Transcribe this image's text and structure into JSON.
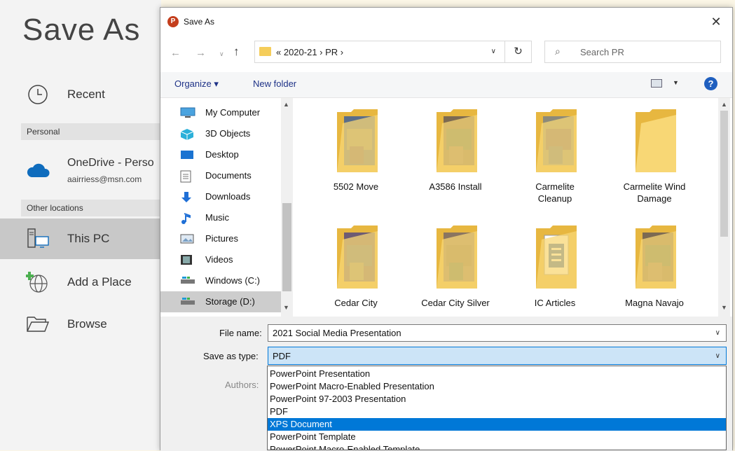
{
  "backstage": {
    "title": "Save As",
    "recent_label": "Recent",
    "personal_section": "Personal",
    "onedrive_name": "OneDrive - Perso",
    "onedrive_email": "aairriess@msn.com",
    "other_section": "Other locations",
    "this_pc_label": "This PC",
    "add_place_label": "Add a Place",
    "browse_label": "Browse"
  },
  "dialog": {
    "title": "Save As",
    "app_icon_letter": "P",
    "close_glyph": "✕",
    "address": {
      "path": "«  2020-21  ›  PR  ›"
    },
    "search_placeholder": "Search PR",
    "toolbar": {
      "organize_label": "Organize ▾",
      "new_folder_label": "New folder",
      "help_glyph": "?"
    },
    "nav_items": [
      {
        "label": "My Computer",
        "icon": "computer-icon",
        "selected": false
      },
      {
        "label": "3D Objects",
        "icon": "3d-objects-icon",
        "selected": false
      },
      {
        "label": "Desktop",
        "icon": "desktop-icon",
        "selected": false
      },
      {
        "label": "Documents",
        "icon": "documents-icon",
        "selected": false
      },
      {
        "label": "Downloads",
        "icon": "downloads-icon",
        "selected": false
      },
      {
        "label": "Music",
        "icon": "music-icon",
        "selected": false
      },
      {
        "label": "Pictures",
        "icon": "pictures-icon",
        "selected": false
      },
      {
        "label": "Videos",
        "icon": "videos-icon",
        "selected": false
      },
      {
        "label": "Windows (C:)",
        "icon": "drive-icon",
        "selected": false
      },
      {
        "label": "Storage (D:)",
        "icon": "drive-icon",
        "selected": true
      }
    ],
    "folders": [
      {
        "name": "5502 Move",
        "kind": "photo"
      },
      {
        "name": "A3586 Install",
        "kind": "photo"
      },
      {
        "name": "Carmelite\nCleanup",
        "kind": "photo"
      },
      {
        "name": "Carmelite Wind\nDamage",
        "kind": "empty"
      },
      {
        "name": "Cedar City",
        "kind": "photo"
      },
      {
        "name": "Cedar City Silver",
        "kind": "photo"
      },
      {
        "name": "IC Articles",
        "kind": "docs"
      },
      {
        "name": "Magna Navajo",
        "kind": "photo"
      }
    ],
    "file_name_label": "File name:",
    "file_name_value": "2021 Social Media Presentation",
    "save_type_label": "Save as type:",
    "save_type_value": "PDF",
    "authors_label": "Authors:",
    "type_options": [
      {
        "label": "PowerPoint Presentation",
        "highlighted": false
      },
      {
        "label": "PowerPoint Macro-Enabled Presentation",
        "highlighted": false
      },
      {
        "label": "PowerPoint 97-2003 Presentation",
        "highlighted": false
      },
      {
        "label": "PDF",
        "highlighted": false
      },
      {
        "label": "XPS Document",
        "highlighted": true
      },
      {
        "label": "PowerPoint Template",
        "highlighted": false
      },
      {
        "label": "PowerPoint Macro-Enabled Template",
        "highlighted": false
      }
    ]
  },
  "colors": {
    "accent": "#0078d7",
    "selection_bg": "#cce4f7",
    "folder": "#f5cd5a",
    "powerpoint": "#c43e1c"
  }
}
